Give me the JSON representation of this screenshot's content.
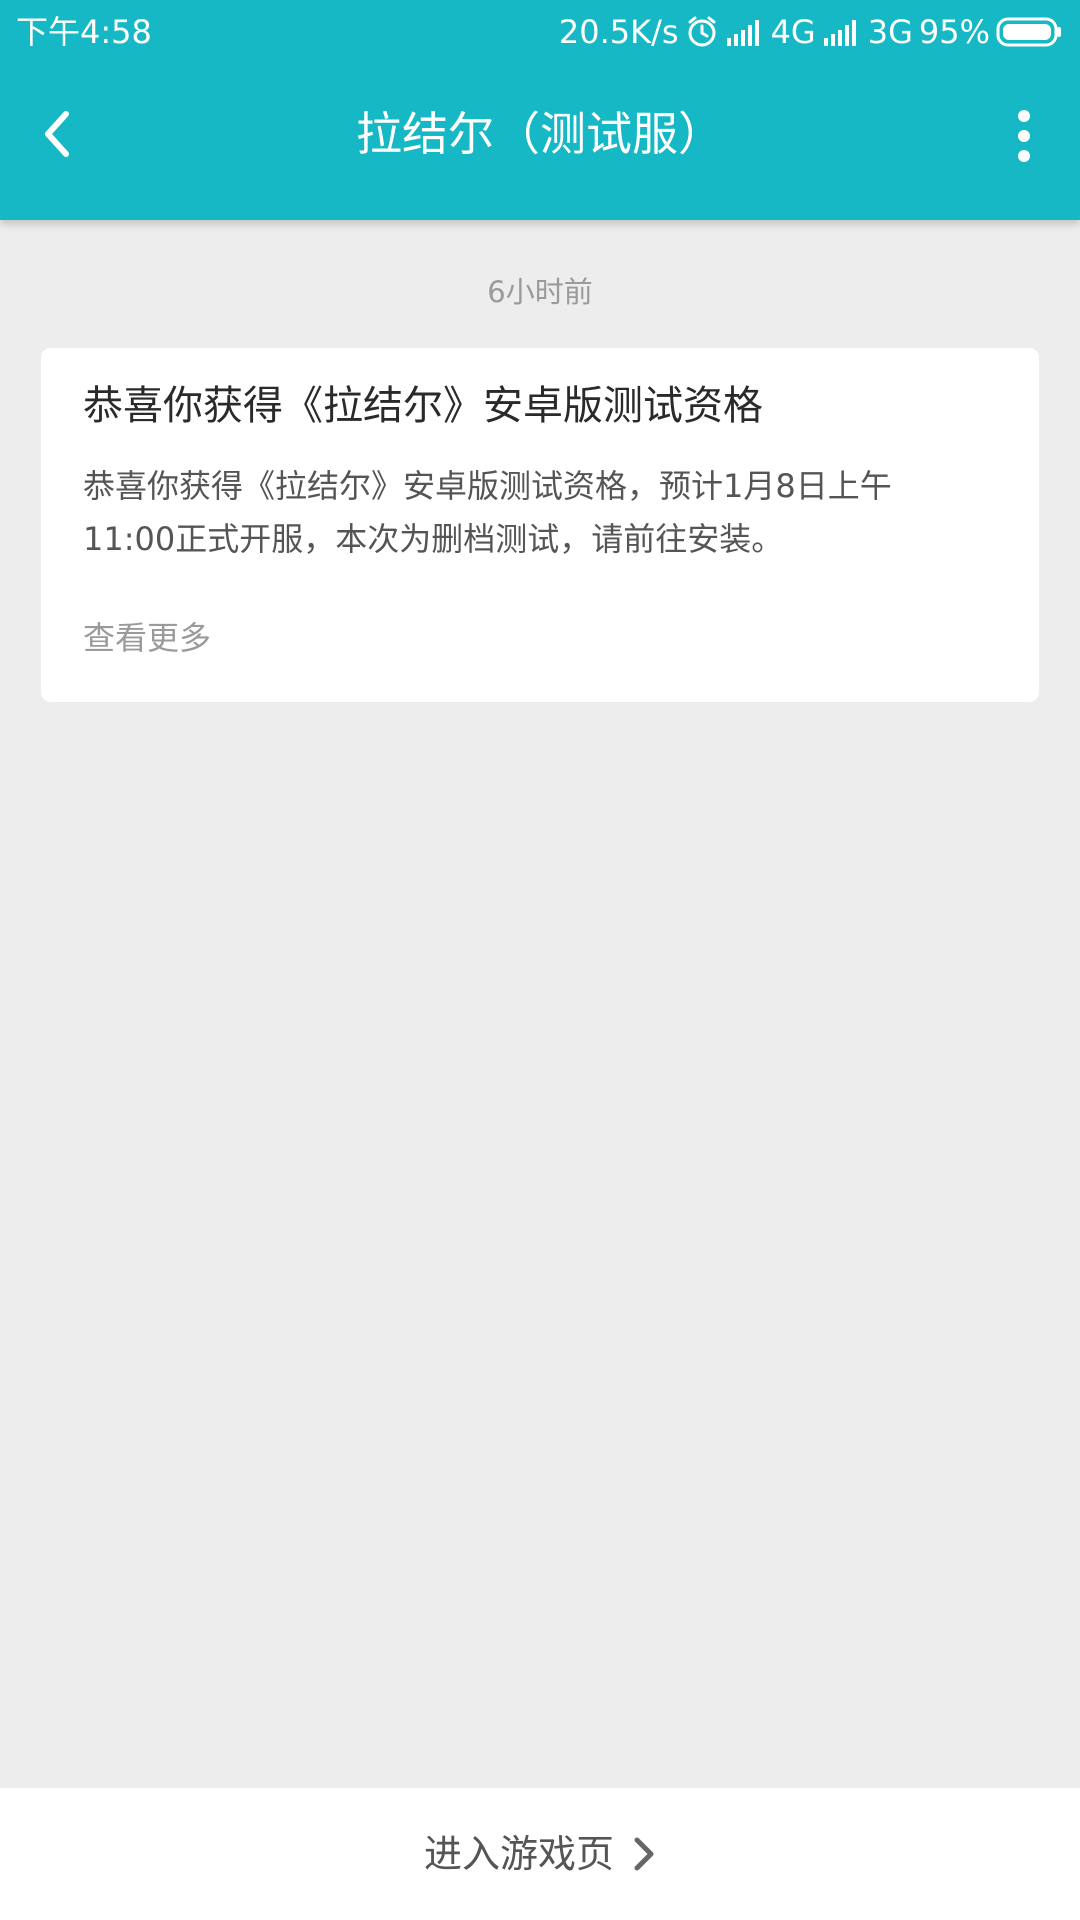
{
  "status_bar": {
    "time": "下午4:58",
    "speed": "20.5K/s",
    "network1": "4G",
    "network2": "3G",
    "battery": "95%",
    "icons": [
      "alarm-icon",
      "signal-icon",
      "signal-icon",
      "battery-icon"
    ]
  },
  "nav": {
    "title": "拉结尔（测试服）",
    "back_icon": "chevron-left-icon",
    "more_icon": "more-vertical-icon"
  },
  "message": {
    "timestamp": "6小时前",
    "title": "恭喜你获得《拉结尔》安卓版测试资格",
    "body": "恭喜你获得《拉结尔》安卓版测试资格，预计1月8日上午11:00正式开服，本次为删档测试，请前往安装。",
    "more_label": "查看更多"
  },
  "bottom": {
    "label": "进入游戏页",
    "icon": "chevron-right-icon"
  },
  "colors": {
    "accent": "#16b8c6",
    "background": "#ededed",
    "card": "#ffffff"
  }
}
